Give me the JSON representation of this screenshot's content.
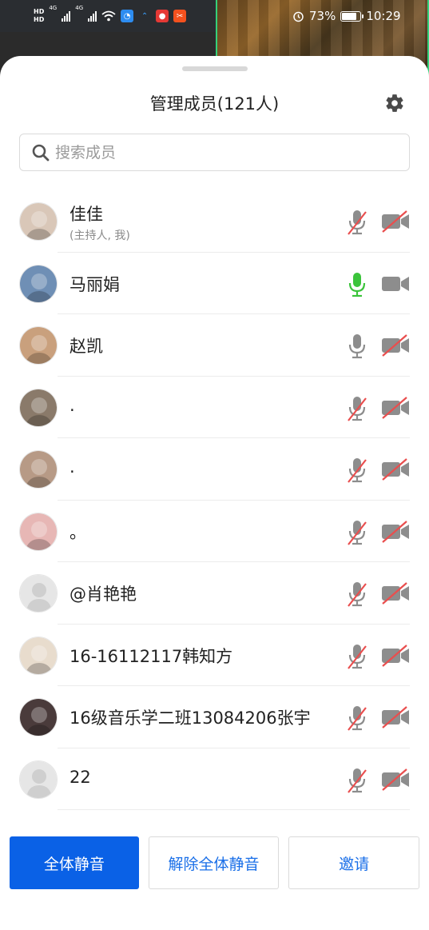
{
  "status": {
    "battery": "73%",
    "time": "10:29",
    "network_labels": [
      "HD",
      "HD",
      "4G",
      "4G"
    ]
  },
  "sheet": {
    "title": "管理成员(121人)",
    "search_placeholder": "搜索成员"
  },
  "members": [
    {
      "name": "佳佳",
      "subtitle": "(主持人, 我)",
      "mic": "muted",
      "camera": "off",
      "avatar_color": "#d9c7b8"
    },
    {
      "name": "马丽娟",
      "subtitle": "",
      "mic": "active",
      "camera": "on",
      "avatar_color": "#6f8fb5"
    },
    {
      "name": "赵凯",
      "subtitle": "",
      "mic": "on",
      "camera": "off",
      "avatar_color": "#c9a07d"
    },
    {
      "name": ".",
      "subtitle": "",
      "mic": "muted",
      "camera": "off",
      "avatar_color": "#8a7a6a"
    },
    {
      "name": ".",
      "subtitle": "",
      "mic": "muted",
      "camera": "off",
      "avatar_color": "#b79a86"
    },
    {
      "name": "。",
      "subtitle": "",
      "mic": "muted",
      "camera": "off",
      "avatar_color": "#e7b7b5"
    },
    {
      "name": "@肖艳艳",
      "subtitle": "",
      "mic": "muted",
      "camera": "off",
      "avatar_color": "default"
    },
    {
      "name": "16-16112117韩知方",
      "subtitle": "",
      "mic": "muted",
      "camera": "off",
      "avatar_color": "#e8dccd"
    },
    {
      "name": "16级音乐学二班13084206张宇",
      "subtitle": "",
      "mic": "muted",
      "camera": "off",
      "avatar_color": "#4a3b3b"
    },
    {
      "name": "22",
      "subtitle": "",
      "mic": "muted",
      "camera": "off",
      "avatar_color": "default"
    }
  ],
  "actions": {
    "mute_all": "全体静音",
    "unmute_all": "解除全体静音",
    "invite": "邀请"
  },
  "colors": {
    "primary": "#0a61e6",
    "link": "#1a6fe8",
    "active_mic": "#3bc43b",
    "muted_slash": "#e94e4e",
    "icon_gray": "#8d8d8d"
  }
}
